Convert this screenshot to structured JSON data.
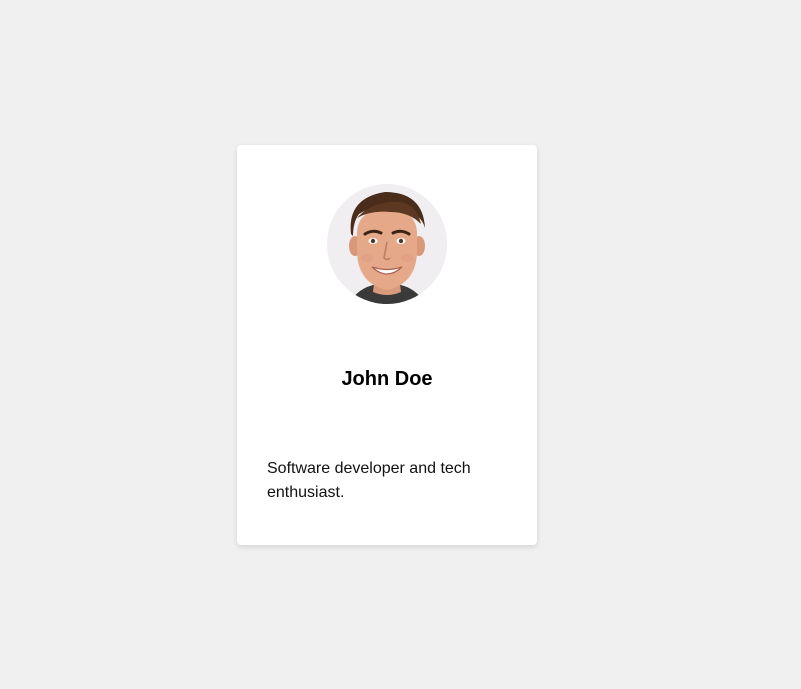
{
  "profile_card": {
    "avatar_icon": "person-portrait",
    "name": "John Doe",
    "bio": "Software developer and tech enthusiast."
  },
  "colors": {
    "page_background": "#f0f0f0",
    "card_background": "#ffffff",
    "avatar_background": "#f1eef2"
  }
}
